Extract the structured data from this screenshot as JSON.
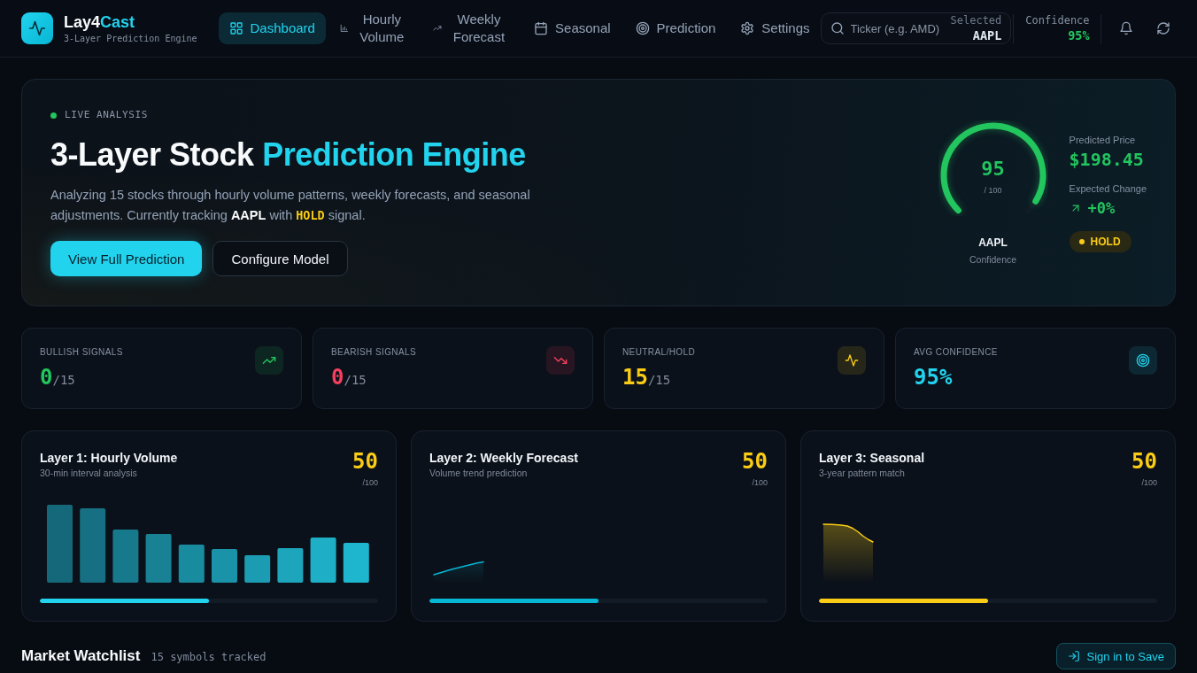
{
  "header": {
    "brand": {
      "title_parts": [
        {
          "text": "Lay4",
          "accent": false
        },
        {
          "text": "Cast",
          "accent": true
        }
      ],
      "subtitle": "3-Layer Prediction Engine"
    },
    "nav": [
      {
        "label": "Dashboard",
        "selected": true
      },
      {
        "label": "Hourly Volume",
        "selected": false
      },
      {
        "label": "Weekly Forecast",
        "selected": false
      },
      {
        "label": "Seasonal",
        "selected": false
      },
      {
        "label": "Prediction",
        "selected": false
      },
      {
        "label": "Settings",
        "selected": false
      }
    ],
    "search": {
      "placeholder": "Ticker (e.g. AMD)",
      "selected_label": "Selected",
      "selected_value": "AAPL"
    },
    "confidence": {
      "label": "Confidence",
      "value": "95%"
    }
  },
  "hero": {
    "live_label": "LIVE ANALYSIS",
    "title_parts": [
      {
        "text": "3-Layer Stock ",
        "accent": false
      },
      {
        "text": "Prediction Engine",
        "accent": true
      }
    ],
    "description": [
      {
        "text": "Analyzing 15 stocks through hourly volume patterns, weekly forecasts, and seasonal adjustments. Currently tracking ",
        "kind": "plain"
      },
      {
        "text": "AAPL",
        "kind": "ticker"
      },
      {
        "text": " with ",
        "kind": "plain"
      },
      {
        "text": "HOLD",
        "kind": "signal"
      },
      {
        "text": " signal.",
        "kind": "plain"
      }
    ],
    "buttons": [
      {
        "label": "View Full Prediction",
        "kind": "primary"
      },
      {
        "label": "Configure Model",
        "kind": "secondary"
      }
    ],
    "gauge": {
      "value": "95",
      "max": "/ 100",
      "level": 0.95,
      "ticker": "AAPL",
      "caption": "Confidence"
    },
    "predicted_price": {
      "label": "Predicted Price",
      "value": "$198.45"
    },
    "expected_change": {
      "label": "Expected Change",
      "value": "+0%"
    },
    "signal": "HOLD"
  },
  "stats": [
    {
      "label": "BULLISH SIGNALS",
      "value": "0",
      "suffix": "/15",
      "color": "#22c55e"
    },
    {
      "label": "BEARISH SIGNALS",
      "value": "0",
      "suffix": "/15",
      "color": "#f43f5e"
    },
    {
      "label": "NEUTRAL/HOLD",
      "value": "15",
      "suffix": "/15",
      "color": "#facc15"
    },
    {
      "label": "AVG CONFIDENCE",
      "value": "95%",
      "color": "#22d3ee"
    }
  ],
  "layers": [
    {
      "title": "Layer 1: Hourly Volume",
      "subtitle": "30-min interval analysis",
      "score": "50",
      "score_max": "/100",
      "kind": "bars",
      "color": "#22d3ee",
      "level": 0.5
    },
    {
      "title": "Layer 2: Weekly Forecast",
      "subtitle": "Volume trend prediction",
      "score": "50",
      "score_max": "/100",
      "kind": "line",
      "color": "#06b6d4",
      "level": 0.5
    },
    {
      "title": "Layer 3: Seasonal",
      "subtitle": "3-year pattern match",
      "score": "50",
      "score_max": "/100",
      "kind": "area",
      "color": "#facc15",
      "level": 0.5
    }
  ],
  "watchlist": {
    "title": "Market Watchlist",
    "count": "15 symbols tracked",
    "button": "Sign in to Save"
  }
}
